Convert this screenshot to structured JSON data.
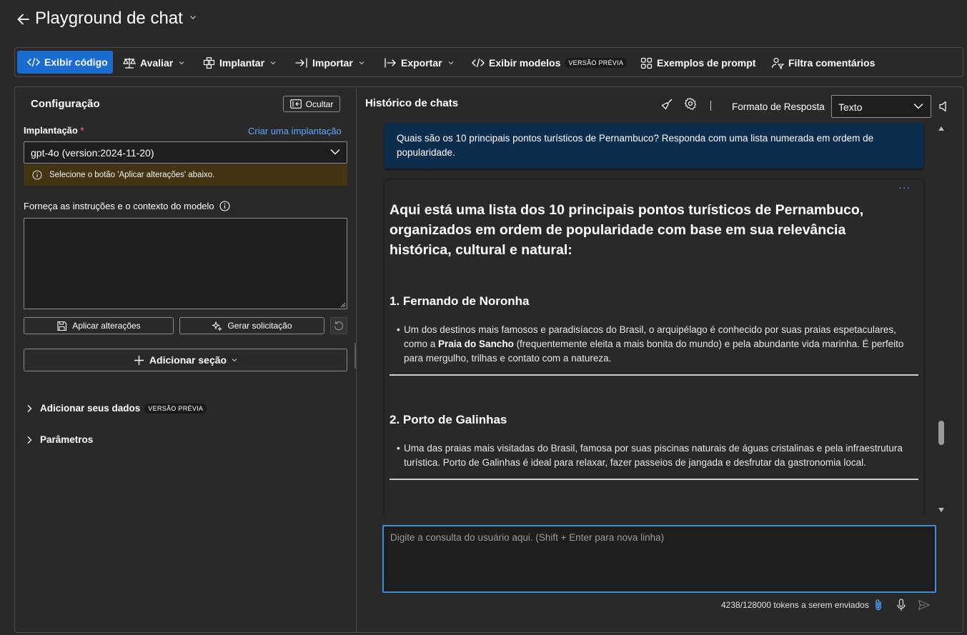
{
  "header": {
    "title": "Playground de chat"
  },
  "toolbar": {
    "view_code": "Exibir código",
    "evaluate": "Avaliar",
    "deploy": "Implantar",
    "import": "Importar",
    "export": "Exportar",
    "view_models": "Exibir modelos",
    "preview_badge": "VERSÃO PRÉVIA",
    "prompt_examples": "Exemplos de prompt",
    "filter_comments": "Filtra comentários"
  },
  "config": {
    "title": "Configuração",
    "hide_label": "Ocultar",
    "deployment_label": "Implantação",
    "required_mark": "*",
    "create_link": "Criar uma implantação",
    "deployment_value": "gpt-4o (version:2024-11-20)",
    "warning": "Selecione o botão 'Aplicar alterações' abaixo.",
    "instructions_label": "Forneça as instruções e o contexto do modelo",
    "instructions_value": "",
    "apply_label": "Aplicar alterações",
    "generate_label": "Gerar solicitação",
    "add_section_label": "Adicionar seção",
    "add_data_label": "Adicionar seus dados",
    "add_data_badge": "VERSÃO PRÉVIA",
    "parameters_label": "Parâmetros"
  },
  "chat": {
    "title": "Histórico de chats",
    "response_format_label": "Formato de Resposta",
    "response_format_value": "Texto",
    "user_message": "Quais são os 10 principais pontos turísticos de Pernambuco? Responda com uma lista numerada em ordem de popularidade.",
    "assistant": {
      "intro_pre": "Aqui está uma lista dos ",
      "intro_bold": "10 principais pontos turísticos de Pernambuco",
      "intro_post": ", organizados em ordem de popularidade com base em sua relevância histórica, cultural e natural:",
      "items": [
        {
          "heading": "1. Fernando de Noronha",
          "text_pre": "Um dos destinos mais famosos e paradisíacos do Brasil, o arquipélago é conhecido por suas praias espetaculares, como a ",
          "text_bold": "Praia do Sancho",
          "text_post": " (frequentemente eleita a mais bonita do mundo) e pela abundante vida marinha. É perfeito para mergulho, trilhas e contato com a natureza."
        },
        {
          "heading": "2. Porto de Galinhas",
          "text": "Uma das praias mais visitadas do Brasil, famosa por suas piscinas naturais de águas cristalinas e pela infraestrutura turística. Porto de Galinhas é ideal para relaxar, fazer passeios de jangada e desfrutar da gastronomia local."
        }
      ]
    },
    "input_placeholder": "Digite a consulta do usuário aqui. (Shift + Enter para nova linha)",
    "token_count": "4238/128000 tokens a serem enviados"
  },
  "colors": {
    "background": "#292929",
    "primary": "#1a6cd1",
    "link": "#5fa8ff",
    "user_bubble": "#0c2d4e",
    "warning_bg": "#443512",
    "input_focus": "#3c8fe0"
  },
  "icons": {
    "back": "arrow-left-icon",
    "code": "code-icon",
    "evaluate": "scale-icon",
    "deploy": "cube-icon",
    "import": "import-icon",
    "export": "export-icon",
    "prompt_examples": "grid-icon",
    "filter": "filter-people-icon",
    "hide": "panel-collapse-icon",
    "info": "info-icon",
    "save": "save-icon",
    "sparkle": "sparkle-icon",
    "reset": "reset-icon",
    "add": "plus-icon",
    "clear": "broom-icon",
    "settings": "gear-icon",
    "speaker": "speaker-icon",
    "attach": "paperclip-icon",
    "mic": "microphone-icon",
    "send": "send-icon"
  }
}
